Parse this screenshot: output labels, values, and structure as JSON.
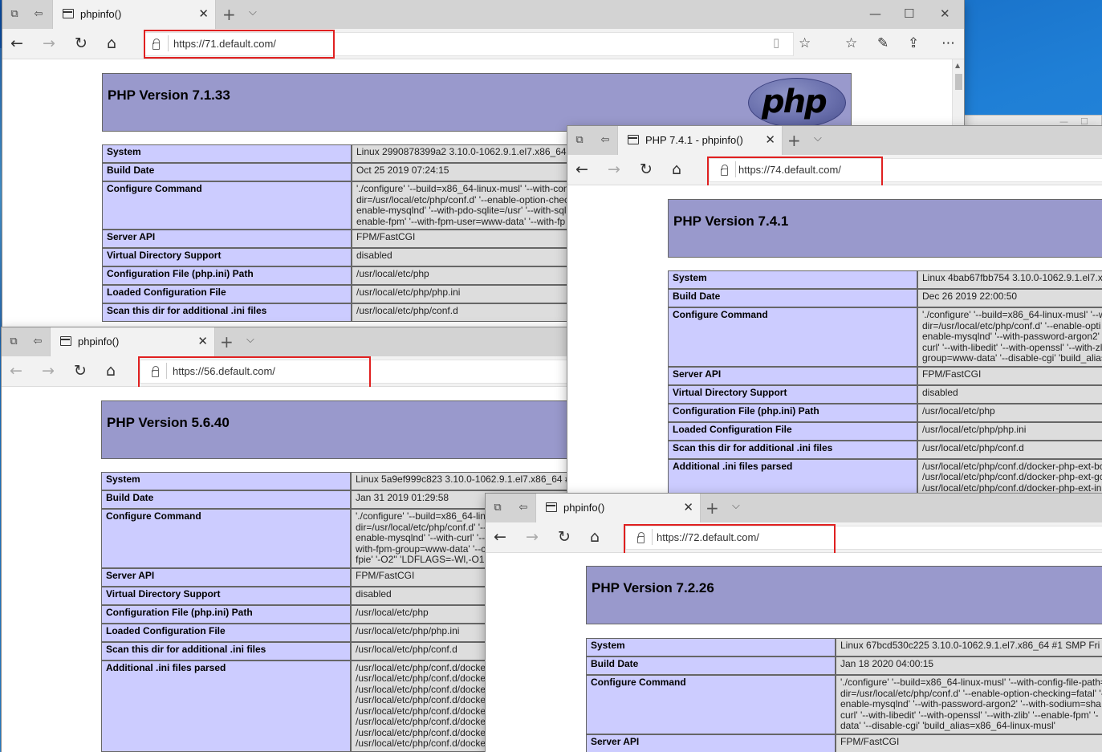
{
  "windows": {
    "w71": {
      "tab_title": "phpinfo()",
      "url": "https://71.default.com/",
      "version_title": "PHP Version 7.1.33",
      "logo_text": "php",
      "rows": [
        {
          "key": "System",
          "value": [
            "Linux 2990878399a2 3.10.0-1062.9.1.el7.x86_64"
          ]
        },
        {
          "key": "Build Date",
          "value": [
            "Oct 25 2019 07:24:15"
          ]
        },
        {
          "key": "Configure Command",
          "value": [
            "'./configure' '--build=x86_64-linux-musl' '--with-con",
            "dir=/usr/local/etc/php/conf.d' '--enable-option-chec",
            "enable-mysqlnd' '--with-pdo-sqlite=/usr' '--with-sql",
            "enable-fpm' '--with-fpm-user=www-data' '--with-fp"
          ]
        },
        {
          "key": "Server API",
          "value": [
            "FPM/FastCGI"
          ]
        },
        {
          "key": "Virtual Directory Support",
          "value": [
            "disabled"
          ]
        },
        {
          "key": "Configuration File (php.ini) Path",
          "value": [
            "/usr/local/etc/php"
          ]
        },
        {
          "key": "Loaded Configuration File",
          "value": [
            "/usr/local/etc/php/php.ini"
          ]
        },
        {
          "key": "Scan this dir for additional .ini files",
          "value": [
            "/usr/local/etc/php/conf.d"
          ]
        }
      ]
    },
    "w74": {
      "tab_title": "PHP 7.4.1 - phpinfo()",
      "url": "https://74.default.com/",
      "version_title": "PHP Version 7.4.1",
      "rows": [
        {
          "key": "System",
          "value": [
            "Linux 4bab67fbb754 3.10.0-1062.9.1.el7.x"
          ]
        },
        {
          "key": "Build Date",
          "value": [
            "Dec 26 2019 22:00:50"
          ]
        },
        {
          "key": "Configure Command",
          "value": [
            "'./configure' '--build=x86_64-linux-musl' '--w",
            "dir=/usr/local/etc/php/conf.d' '--enable-opti",
            "enable-mysqlnd' '--with-password-argon2' '",
            "curl' '--with-libedit' '--with-openssl' '--with-zl",
            "group=www-data' '--disable-cgi' 'build_alias"
          ]
        },
        {
          "key": "Server API",
          "value": [
            "FPM/FastCGI"
          ]
        },
        {
          "key": "Virtual Directory Support",
          "value": [
            "disabled"
          ]
        },
        {
          "key": "Configuration File (php.ini) Path",
          "value": [
            "/usr/local/etc/php"
          ]
        },
        {
          "key": "Loaded Configuration File",
          "value": [
            "/usr/local/etc/php/php.ini"
          ]
        },
        {
          "key": "Scan this dir for additional .ini files",
          "value": [
            "/usr/local/etc/php/conf.d"
          ]
        },
        {
          "key": "Additional .ini files parsed",
          "value": [
            "/usr/local/etc/php/conf.d/docker-php-ext-bc",
            "/usr/local/etc/php/conf.d/docker-php-ext-gc",
            "/usr/local/etc/php/conf.d/docker-php-ext-in"
          ]
        }
      ]
    },
    "w56": {
      "tab_title": "phpinfo()",
      "url": "https://56.default.com/",
      "version_title": "PHP Version 5.6.40",
      "rows": [
        {
          "key": "System",
          "value": [
            "Linux 5a9ef999c823 3.10.0-1062.9.1.el7.x86_64 #"
          ]
        },
        {
          "key": "Build Date",
          "value": [
            "Jan 31 2019 01:29:58"
          ]
        },
        {
          "key": "Configure Command",
          "value": [
            "'./configure' '--build=x86_64-lin",
            "dir=/usr/local/etc/php/conf.d' '--",
            "enable-mysqlnd' '--with-curl' '--",
            "with-fpm-group=www-data' '--c",
            "fpie' '-O2'' 'LDFLAGS=-Wl,-O1"
          ]
        },
        {
          "key": "Server API",
          "value": [
            "FPM/FastCGI"
          ]
        },
        {
          "key": "Virtual Directory Support",
          "value": [
            "disabled"
          ]
        },
        {
          "key": "Configuration File (php.ini) Path",
          "value": [
            "/usr/local/etc/php"
          ]
        },
        {
          "key": "Loaded Configuration File",
          "value": [
            "/usr/local/etc/php/php.ini"
          ]
        },
        {
          "key": "Scan this dir for additional .ini files",
          "value": [
            "/usr/local/etc/php/conf.d"
          ]
        },
        {
          "key": "Additional .ini files parsed",
          "value": [
            "/usr/local/etc/php/conf.d/docke",
            "/usr/local/etc/php/conf.d/docke",
            "/usr/local/etc/php/conf.d/docke",
            "/usr/local/etc/php/conf.d/docke",
            "/usr/local/etc/php/conf.d/docke",
            "/usr/local/etc/php/conf.d/docke",
            "/usr/local/etc/php/conf.d/docke",
            "/usr/local/etc/php/conf.d/docke"
          ]
        }
      ]
    },
    "w72": {
      "tab_title": "phpinfo()",
      "url": "https://72.default.com/",
      "version_title": "PHP Version 7.2.26",
      "rows": [
        {
          "key": "System",
          "value": [
            "Linux 67bcd530c225 3.10.0-1062.9.1.el7.x86_64 #1 SMP Fri"
          ]
        },
        {
          "key": "Build Date",
          "value": [
            "Jan 18 2020 04:00:15"
          ]
        },
        {
          "key": "Configure Command",
          "value": [
            "'./configure' '--build=x86_64-linux-musl' '--with-config-file-path=",
            "dir=/usr/local/etc/php/conf.d' '--enable-option-checking=fatal' '-",
            "enable-mysqlnd' '--with-password-argon2' '--with-sodium=sha",
            "curl' '--with-libedit' '--with-openssl' '--with-zlib' '--enable-fpm' '-",
            "data' '--disable-cgi' 'build_alias=x86_64-linux-musl'"
          ]
        },
        {
          "key": "Server API",
          "value": [
            "FPM/FastCGI"
          ]
        }
      ]
    }
  },
  "icons": {
    "back": "←",
    "forward": "→",
    "refresh": "↻",
    "home": "⌂",
    "newtab": "+",
    "tabdrop": "⌵",
    "close": "✕",
    "minimize": "—",
    "maximize": "☐",
    "reading": "▯",
    "favorite": "☆",
    "favorites": "☆",
    "pen": "✎",
    "share": "⇪",
    "more": "⋯",
    "tabs_aside": "⧉",
    "tabs_set": "⇦"
  },
  "colors": {
    "header_bg": "#9999cc",
    "key_bg": "#ccccff",
    "value_bg": "#dddddd",
    "highlight": "#e02020"
  }
}
